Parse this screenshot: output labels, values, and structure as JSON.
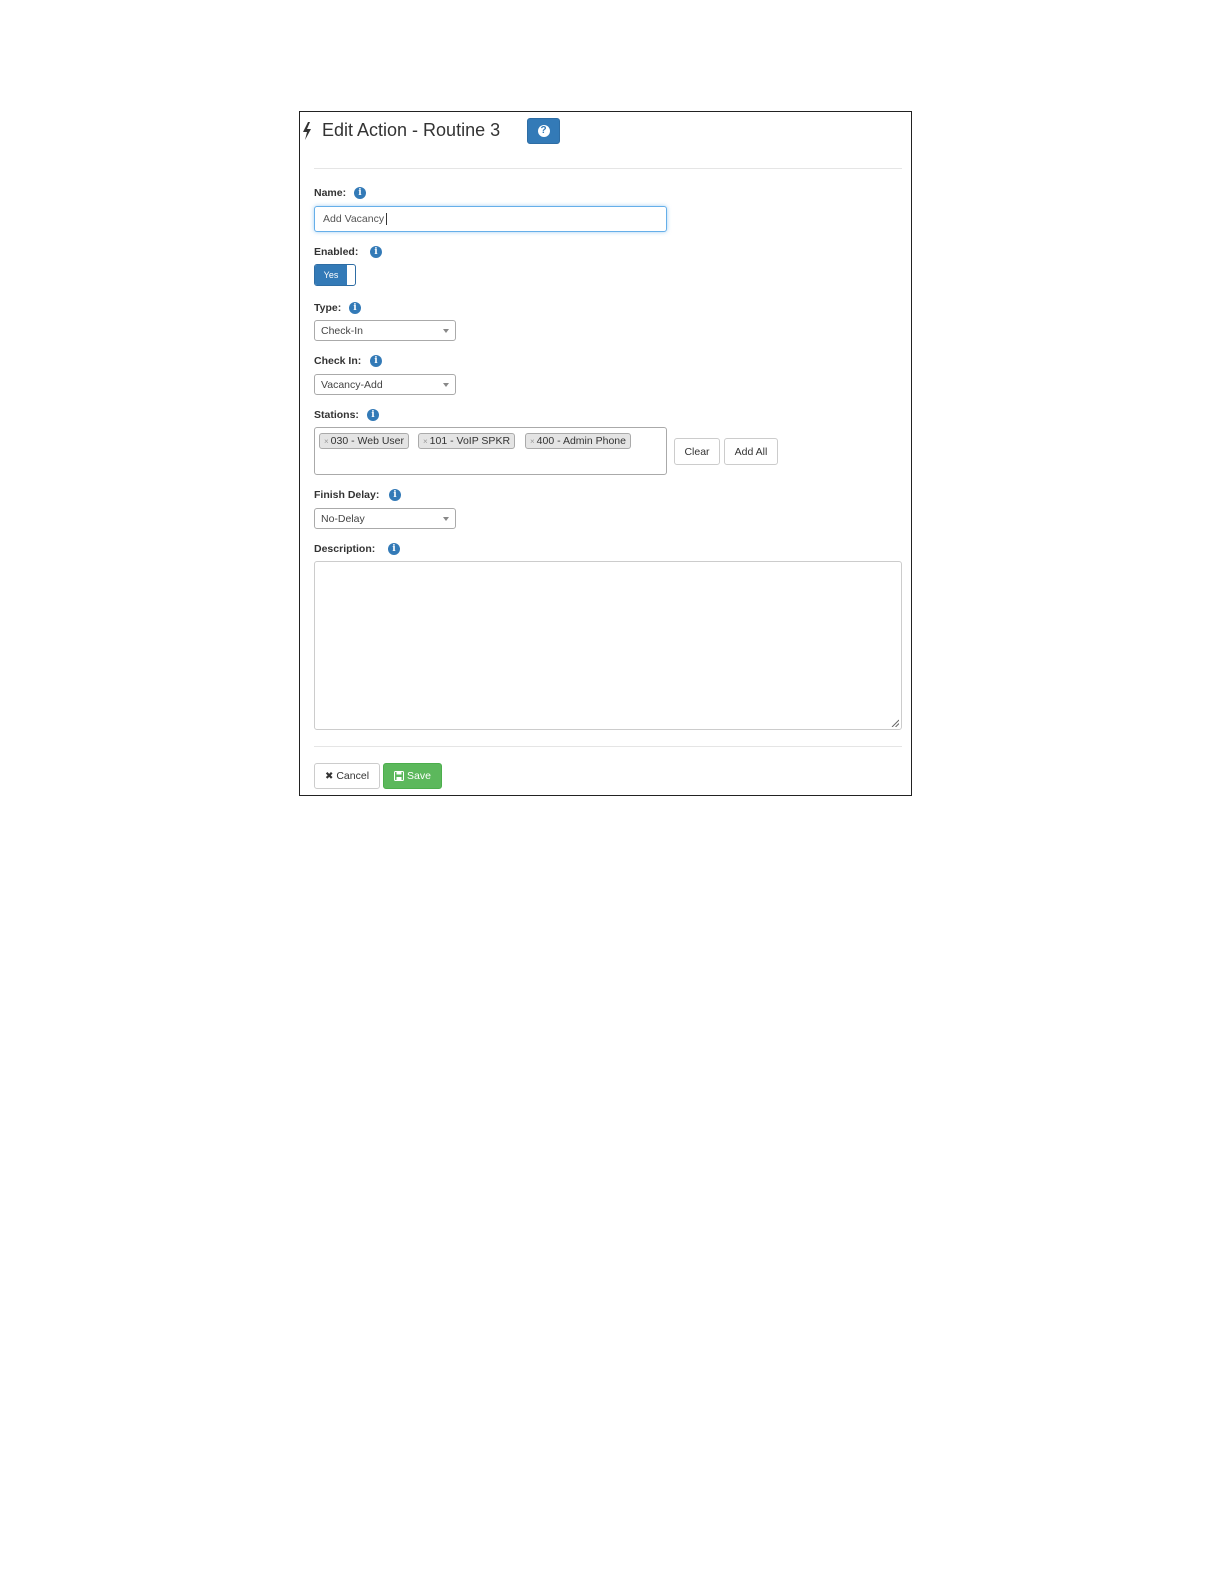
{
  "header": {
    "title": "Edit Action - Routine 3",
    "title_icon": "bolt-icon",
    "help_icon": "question-circle-icon"
  },
  "form": {
    "name": {
      "label": "Name:",
      "value": "Add Vacancy"
    },
    "enabled": {
      "label": "Enabled:",
      "toggle_label": "Yes",
      "state": true
    },
    "type": {
      "label": "Type:",
      "value": "Check-In"
    },
    "check_in": {
      "label": "Check In:",
      "value": "Vacancy-Add"
    },
    "stations": {
      "label": "Stations:",
      "chips": [
        "030 - Web User",
        "101 - VoIP SPKR",
        "400 - Admin Phone"
      ],
      "clear_label": "Clear",
      "add_all_label": "Add All"
    },
    "finish_delay": {
      "label": "Finish Delay:",
      "value": "No-Delay"
    },
    "description": {
      "label": "Description:",
      "value": ""
    }
  },
  "footer": {
    "cancel_label": "Cancel",
    "save_label": "Save"
  },
  "colors": {
    "primary": "#337ab7",
    "success": "#5cb85c"
  }
}
